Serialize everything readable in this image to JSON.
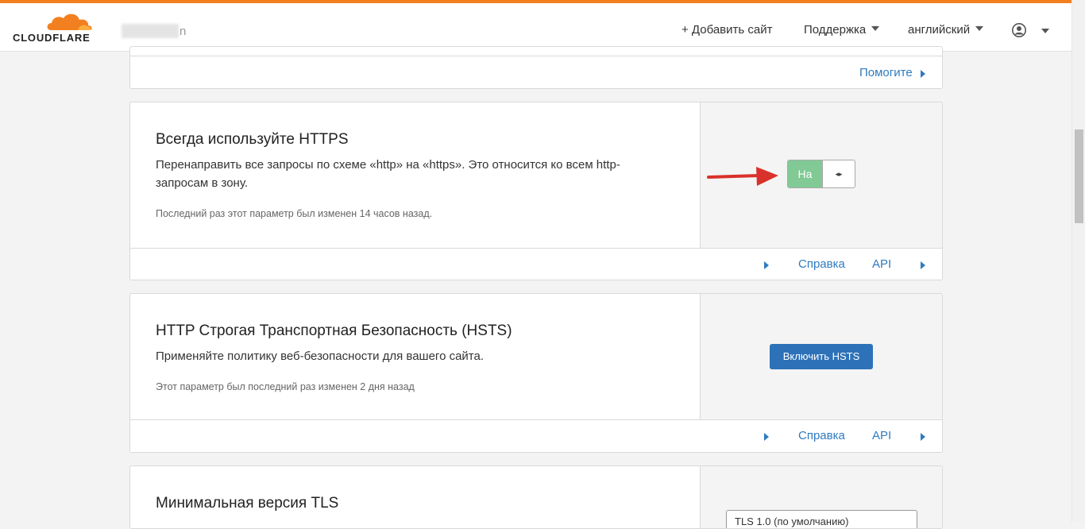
{
  "header": {
    "brand": "CLOUDFLARE",
    "account_suffix": "n",
    "add_site": "+ Добавить сайт",
    "support": "Поддержка",
    "language": "английский"
  },
  "top_card": {
    "help_link": "Помогите"
  },
  "always_https": {
    "title": "Всегда используйте HTTPS",
    "description": "Перенаправить все запросы по схеме «http» на «https». Это относится ко всем http-запросам в зону.",
    "meta": "Последний раз этот параметр был изменен 14 часов назад.",
    "toggle_label": "На",
    "toggle_knob": "◂▸",
    "toggle_state": "on",
    "help": "Справка",
    "api": "API"
  },
  "hsts": {
    "title": "HTTP Строгая Транспортная Безопасность (HSTS)",
    "description": "Применяйте политику веб-безопасности для вашего сайта.",
    "meta": "Этот параметр был последний раз изменен 2 дня назад",
    "button": "Включить HSTS",
    "help": "Справка",
    "api": "API"
  },
  "tls": {
    "title": "Минимальная версия TLS",
    "select_value": "TLS 1.0 (по умолчанию)"
  },
  "colors": {
    "accent": "#f38020",
    "link": "#2f7bbf",
    "toggle_on": "#81c995",
    "primary_button": "#2d72b8",
    "annotation_arrow": "#d9312b"
  }
}
